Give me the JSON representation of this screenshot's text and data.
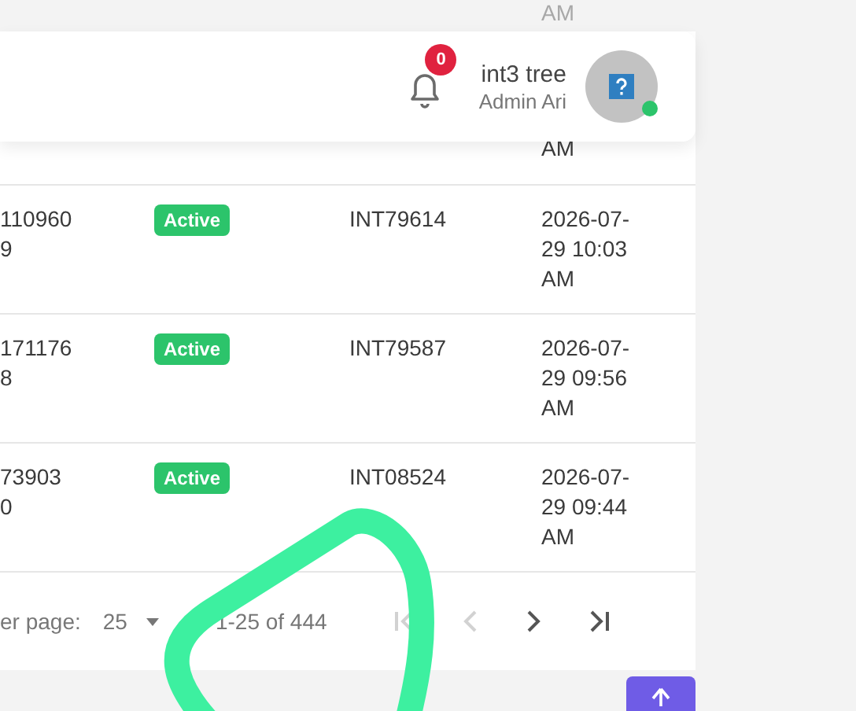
{
  "top_faint_text": "AM",
  "header": {
    "notification_count": "0",
    "user_name": "int3 tree",
    "user_role": "Admin Ari",
    "online": true
  },
  "table": {
    "partial_row_text": "AM",
    "rows": [
      {
        "column_1": [
          "110960",
          "9"
        ],
        "status": "Active",
        "id": "INT79614",
        "date": "2026-07-29 10:03 AM"
      },
      {
        "column_1": [
          "171176",
          "8"
        ],
        "status": "Active",
        "id": "INT79587",
        "date": "2026-07-29 09:56 AM"
      },
      {
        "column_1": [
          "73903",
          "0"
        ],
        "status": "Active",
        "id": "INT08524",
        "date": "2026-07-29 09:44 AM"
      }
    ]
  },
  "pagination": {
    "rows_per_page_label": "er page:",
    "rows_per_page": "25",
    "range": "1-25 of 444",
    "first_disabled": true,
    "prev_disabled": true,
    "next_disabled": false,
    "last_disabled": false
  }
}
